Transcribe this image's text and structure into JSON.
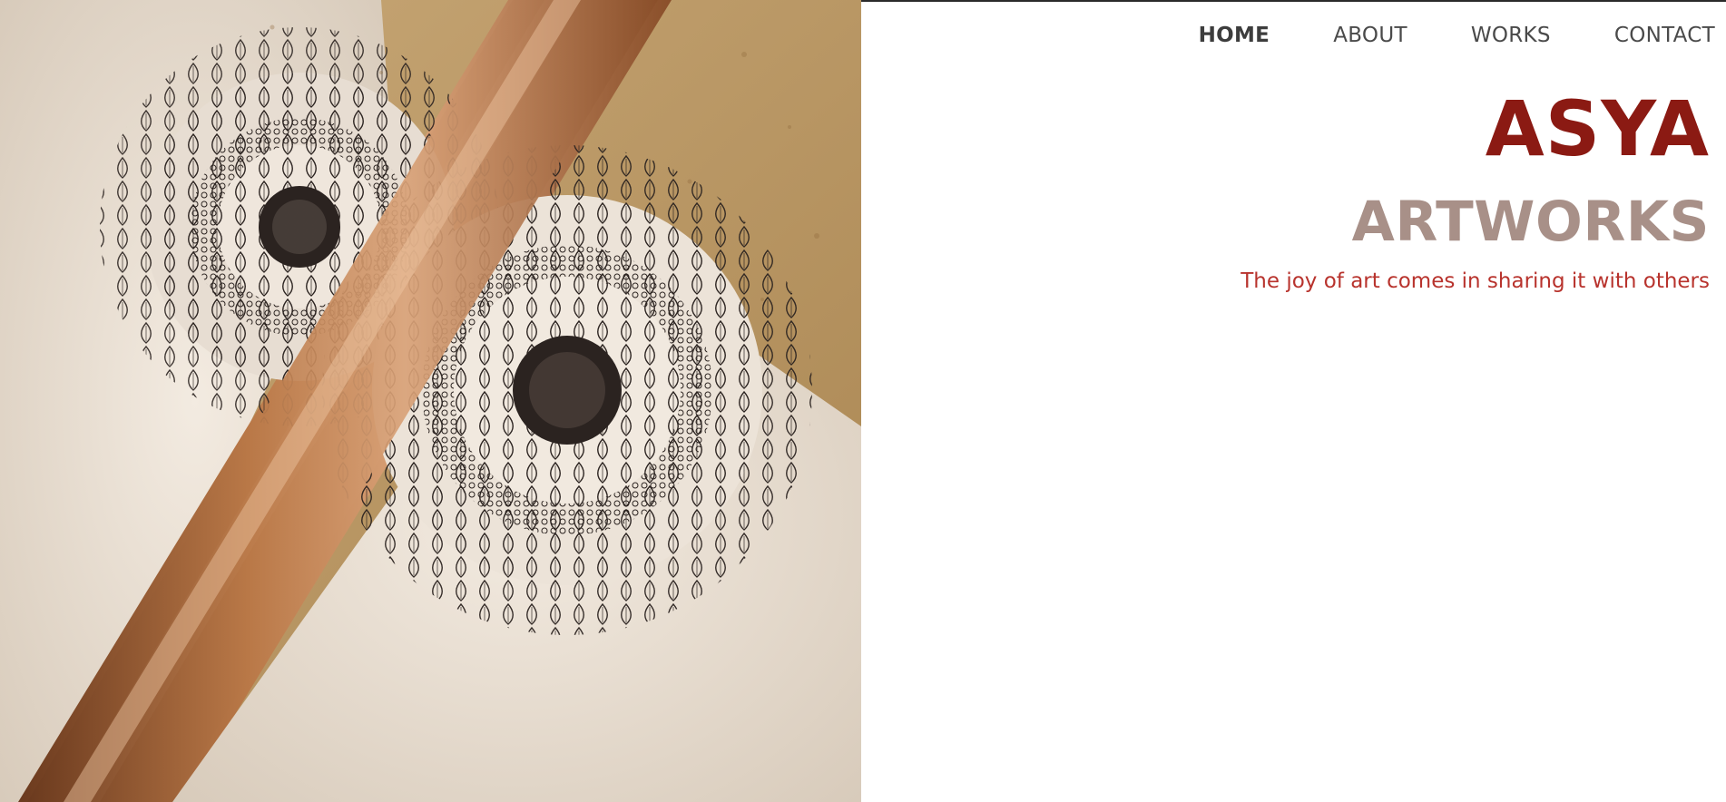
{
  "nav": {
    "items": [
      {
        "label": "HOME",
        "active": true
      },
      {
        "label": "ABOUT",
        "active": false
      },
      {
        "label": "WORKS",
        "active": false
      },
      {
        "label": "CONTACT",
        "active": false
      }
    ]
  },
  "brand": {
    "name": "ASYA",
    "subtitle": "ARTWORKS",
    "tagline": "The joy of art comes in sharing it with others"
  },
  "colors": {
    "brand_name": "#8b1a13",
    "brand_subtitle": "#a89088",
    "tagline": "#b8332d",
    "nav_text": "#4a4a4a"
  },
  "hero": {
    "icon": "mandala-artwork-photo"
  }
}
